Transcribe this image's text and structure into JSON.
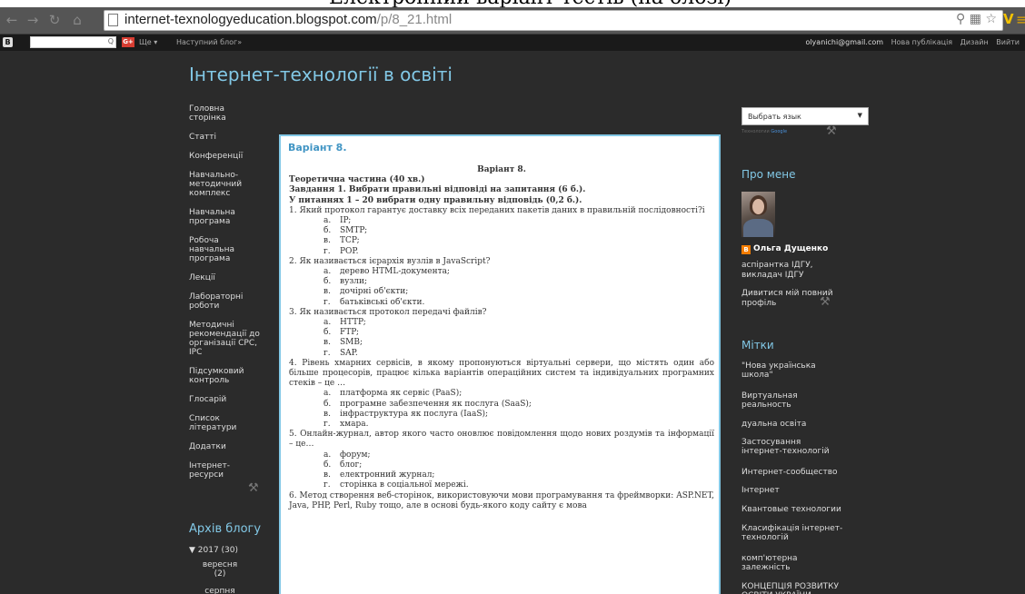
{
  "top_banner": {
    "text": "Електронний варіант тестів (на блозі)"
  },
  "browser": {
    "url_host": "internet-texnologyeducation.blogspot.com",
    "url_path": "/p/8_21.html"
  },
  "navbar": {
    "more": "Ще ▾",
    "next_blog": "Наступний блог»",
    "email": "olyanichi@gmail.com",
    "new_post": "Нова публікація",
    "design": "Дизайн",
    "logout": "Вийти"
  },
  "blog": {
    "title": "Інтернет-технології в освіті"
  },
  "left_nav": [
    "Головна сторінка",
    "Статті",
    "Конференції",
    "Навчально-методичний комплекс",
    "Навчальна програма",
    "Робоча навчальна програма",
    "Лекції",
    "Лабораторні роботи",
    "Методичні рекомендації до організації СРС, ІРС",
    "Підсумковий контроль",
    "Глосарій",
    "Список літератури",
    "Додатки",
    "Інтернет-ресурси"
  ],
  "archive": {
    "title": "Архів блогу",
    "year": "▼  2017 (30)",
    "months": [
      "вересня\n(2)",
      "серпня"
    ]
  },
  "post": {
    "title": "Варіант 8.",
    "body": {
      "variant": "Варіант 8.",
      "theory": "Теоретична частина (40 хв.)",
      "task": "Завдання 1. Вибрати правильні відповіді на запитання (6 б.).",
      "instr": "У питаннях 1 – 20 вибрати одну правильну відповідь (0,2 б.).",
      "q1": "1. Який протокол гарантує доставку всіх переданих пакетів даних в правильній послідовності?і",
      "q1_opts": [
        [
          "а.",
          "IP;"
        ],
        [
          "б.",
          "SMTP;"
        ],
        [
          "в.",
          "TCP;"
        ],
        [
          "г.",
          "POP."
        ]
      ],
      "q2": "2. Як називається ієрархія вузлів в JavaScript?",
      "q2_opts": [
        [
          "а.",
          "дерево HTML-документа;"
        ],
        [
          "б.",
          "вузли;"
        ],
        [
          "в.",
          "дочірні об'єкти;"
        ],
        [
          "г.",
          "батьківські об'єкти."
        ]
      ],
      "q3": "3. Як називається протокол передачі файлів?",
      "q3_opts": [
        [
          "а.",
          "HTTP;"
        ],
        [
          "б.",
          "FTP;"
        ],
        [
          "в.",
          "SMB;"
        ],
        [
          "г.",
          "SAP."
        ]
      ],
      "q4": "4. Рівень хмарних сервісів, в якому пропонуються віртуальні сервери, що містять один або більше процесорів, працює кілька варіантів операційних систем та індивідуальних програмних стеків – це …",
      "q4_opts": [
        [
          "а.",
          "платформа як сервіс (PaaS);"
        ],
        [
          "б.",
          "програмне забезпечення як послуга (SaaS);"
        ],
        [
          "в.",
          "інфраструктура як послуга (IaaS);"
        ],
        [
          "г.",
          "хмара."
        ]
      ],
      "q5": "5. Онлайн-журнал, автор якого часто оновлює повідомлення щодо нових роздумів та інформації – це…",
      "q5_opts": [
        [
          "а.",
          "форум;"
        ],
        [
          "б.",
          "блог;"
        ],
        [
          "в.",
          "електронний журнал;"
        ],
        [
          "г.",
          "сторінка в соціальної мережі."
        ]
      ],
      "q6": "6.   Метод   створення   веб-сторінок,   використовуючи   мови   програмування   та фреймворки: ASP.NET, Java, PHP, Perl, Ruby тощо, але в основі будь-якого коду сайту є мова"
    }
  },
  "sidebar": {
    "lang_select": "Выбрать язык",
    "translate_by": "Технологии",
    "translate_google": "Google",
    "about_title": "Про мене",
    "profile_name": "Ольга Дущенко",
    "profile_desc": "аспірантка ІДГУ, викладач ІДГУ",
    "profile_link": "Дивитися мій повний профіль",
    "labels_title": "Мітки",
    "labels": [
      "\"Нова українська школа\"",
      "Виртуальная реальность",
      "дуальна освіта",
      "Застосування інтернет-технологій",
      "Интернет-сообщество",
      "Інтернет",
      "Квантовые технологии",
      "Класифікація інтернет-технологій",
      "комп'ютерна залежність",
      "КОНЦЕПЦІЯ РОЗВИТКУ ОСВІТИ УКРАЇНИ"
    ]
  }
}
